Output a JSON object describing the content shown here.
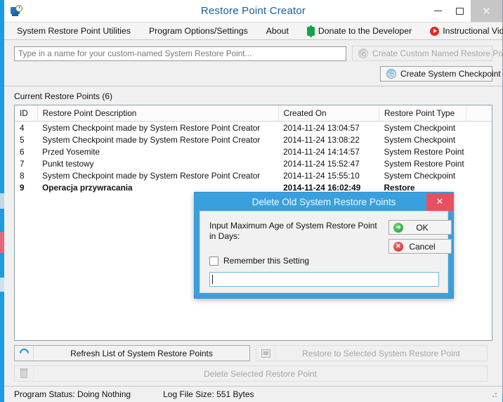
{
  "window": {
    "title": "Restore Point Creator",
    "icon": "system-restore-icon",
    "minimize_label": "–",
    "maximize_label": "□",
    "close_label": "✕"
  },
  "menubar": {
    "items": [
      {
        "label": "System Restore Point Utilities",
        "icon": null
      },
      {
        "label": "Program Options/Settings",
        "icon": null
      },
      {
        "label": "About",
        "icon": null
      },
      {
        "label": "Donate to the Developer",
        "icon": "money-icon"
      },
      {
        "label": "Instructional Videos",
        "icon": "youtube-play-icon"
      }
    ]
  },
  "toolbar": {
    "name_input_placeholder": "Type in a name for your custom-named System Restore Point...",
    "name_input_value": "",
    "create_custom_label": "Create Custom Named Restore Point",
    "create_custom_disabled": true,
    "create_checkpoint_label": "Create System Checkpoint"
  },
  "list": {
    "label": "Current Restore Points (6)",
    "columns": [
      "ID",
      "Restore Point Description",
      "Created On",
      "Restore Point Type",
      ""
    ],
    "rows": [
      {
        "id": "4",
        "description": "System Checkpoint made by System Restore Point Creator",
        "created": "2014-11-24 13:04:57",
        "type": "System Checkpoint",
        "bold": false
      },
      {
        "id": "5",
        "description": "System Checkpoint made by System Restore Point Creator",
        "created": "2014-11-24 13:08:22",
        "type": "System Checkpoint",
        "bold": false
      },
      {
        "id": "6",
        "description": "Przed Yosemite",
        "created": "2014-11-24 14:14:57",
        "type": "System Restore Point",
        "bold": false
      },
      {
        "id": "7",
        "description": "Punkt testowy",
        "created": "2014-11-24 15:52:47",
        "type": "System Restore Point",
        "bold": false
      },
      {
        "id": "8",
        "description": "System Checkpoint made by System Restore Point Creator",
        "created": "2014-11-24 15:55:10",
        "type": "System Checkpoint",
        "bold": false
      },
      {
        "id": "9",
        "description": "Operacja przywracania",
        "created": "2014-11-24 16:02:49",
        "type": "Restore",
        "bold": true
      }
    ]
  },
  "actions": {
    "refresh_label": "Refresh List of System Restore Points",
    "restore_selected_label": "Restore to Selected System Restore Point",
    "restore_selected_disabled": true,
    "delete_selected_label": "Delete Selected Restore Point",
    "delete_selected_disabled": true
  },
  "statusbar": {
    "program_status_label": "Program Status:",
    "program_status_value": "Doing Nothing",
    "log_size_label": "Log File Size:",
    "log_size_value": "551 Bytes"
  },
  "dialog": {
    "title": "Delete Old System Restore Points",
    "close_label": "✕",
    "prompt": "Input Maximum Age of System Restore Point in Days:",
    "ok_label": "OK",
    "cancel_label": "Cancel",
    "remember_label": "Remember this Setting",
    "remember_checked": false,
    "input_value": "",
    "accent_color": "#3aa0dd",
    "close_color": "#e8505f"
  }
}
